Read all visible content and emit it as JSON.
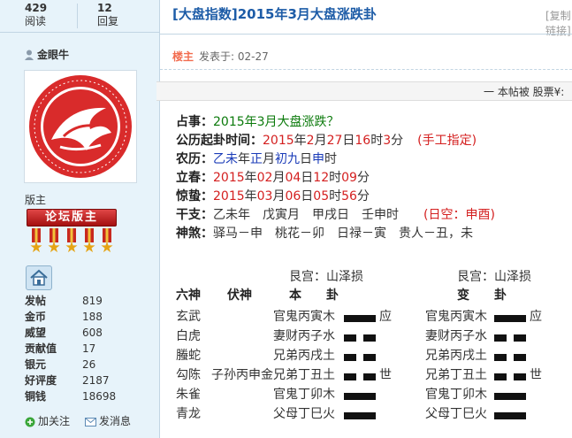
{
  "sidebar": {
    "stats": [
      {
        "num": "429",
        "label": "阅读"
      },
      {
        "num": "12",
        "label": "回复"
      }
    ],
    "username": "金眼牛",
    "rank": "版主",
    "badge": "论坛版主",
    "profile": [
      {
        "k": "发帖",
        "v": "819"
      },
      {
        "k": "金币",
        "v": "188"
      },
      {
        "k": "威望",
        "v": "608"
      },
      {
        "k": "贡献值",
        "v": "17"
      },
      {
        "k": "银元",
        "v": "26"
      },
      {
        "k": "好评度",
        "v": "2187"
      },
      {
        "k": "铜钱",
        "v": "18698"
      }
    ],
    "follow": "加关注",
    "message": "发消息"
  },
  "post": {
    "title": "[大盘指数]2015年3月大盘涨跌卦",
    "copy_link": "[复制链接]",
    "op_tag": "楼主",
    "posted": "发表于: 02-27",
    "notice": "一 本帖被 股票¥:"
  },
  "reading": {
    "question": {
      "k": "占事：",
      "v": "2015年3月大盘涨跌？"
    },
    "gregorian": {
      "k": "公历起卦时间：",
      "y": "2015",
      "yl": "年",
      "mo": "2",
      "mol": "月",
      "d": "27",
      "dl": "日",
      "h": "16",
      "hl": "时",
      "mi": "3",
      "mil": "分",
      "manual": "(手工指定)"
    },
    "lunar": {
      "k": "农历：",
      "ganzhi": "乙未",
      "a": "年",
      "month": "正",
      "b": "月",
      "day": "初九",
      "c": "日",
      "hour": "申",
      "d": "时"
    },
    "lichun": {
      "k": "立春：",
      "y": "2015",
      "yl": "年",
      "mo": "02",
      "mol": "月",
      "d": "04",
      "dl": "日",
      "h": "12",
      "hl": "时",
      "mi": "09",
      "mil": "分"
    },
    "jingzhe": {
      "k": "惊蛰：",
      "y": "2015",
      "yl": "年",
      "mo": "03",
      "mol": "月",
      "d": "06",
      "dl": "日",
      "h": "05",
      "hl": "时",
      "mi": "56",
      "mil": "分"
    },
    "ganzhi": {
      "k": "干支：",
      "v": "乙未年　戊寅月　甲戌日　壬申时",
      "void": "(日空：申酉)"
    },
    "shensha": {
      "k": "神煞：",
      "v": "驿马－申　桃花－卯　日禄－寅　贵人－丑，未"
    }
  },
  "hexagram": {
    "palace_left": "艮宫：山泽损",
    "palace_right": "艮宫：山泽损",
    "headers": {
      "spirit": "六神",
      "hidden": "伏神",
      "base": "本　　卦",
      "changed": "变　　卦"
    },
    "rows": [
      {
        "spirit": "玄武",
        "hidden": "",
        "line": "官鬼丙寅木",
        "yang": true,
        "mark": "应",
        "cline": "官鬼丙寅木",
        "cyang": true,
        "cmark": "应"
      },
      {
        "spirit": "白虎",
        "hidden": "",
        "line": "妻财丙子水",
        "yang": false,
        "mark": "",
        "cline": "妻财丙子水",
        "cyang": false,
        "cmark": ""
      },
      {
        "spirit": "螣蛇",
        "hidden": "",
        "line": "兄弟丙戌土",
        "yang": false,
        "mark": "",
        "cline": "兄弟丙戌土",
        "cyang": false,
        "cmark": ""
      },
      {
        "spirit": "勾陈",
        "hidden": "子孙丙申金",
        "line": "兄弟丁丑土",
        "yang": false,
        "mark": "世",
        "cline": "兄弟丁丑土",
        "cyang": false,
        "cmark": "世"
      },
      {
        "spirit": "朱雀",
        "hidden": "",
        "line": "官鬼丁卯木",
        "yang": true,
        "mark": "",
        "cline": "官鬼丁卯木",
        "cyang": true,
        "cmark": ""
      },
      {
        "spirit": "青龙",
        "hidden": "",
        "line": "父母丁巳火",
        "yang": true,
        "mark": "",
        "cline": "父母丁巳火",
        "cyang": true,
        "cmark": ""
      }
    ]
  }
}
